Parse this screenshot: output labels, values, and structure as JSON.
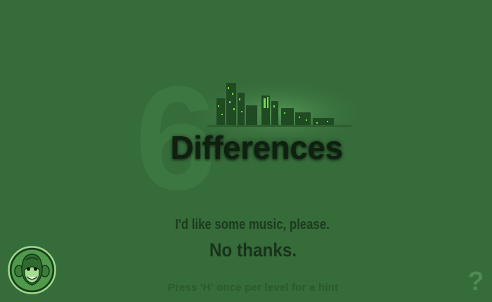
{
  "logo": {
    "number": "6",
    "title": "Differences"
  },
  "menu": {
    "music_on_label": "I'd like some music, please.",
    "music_off_label": "No thanks."
  },
  "footer": {
    "hint_text": "Press 'H' once per level for a hint",
    "help_label": "?"
  },
  "icons": {
    "mascot": "monkey-logo-icon",
    "city": "city-skyline-icon"
  },
  "colors": {
    "background": "#366b3a",
    "title": "#0f1f10",
    "button_text": "#1a321b",
    "hint_text": "#2a5a2d",
    "help_icon": "#4f8a52"
  }
}
